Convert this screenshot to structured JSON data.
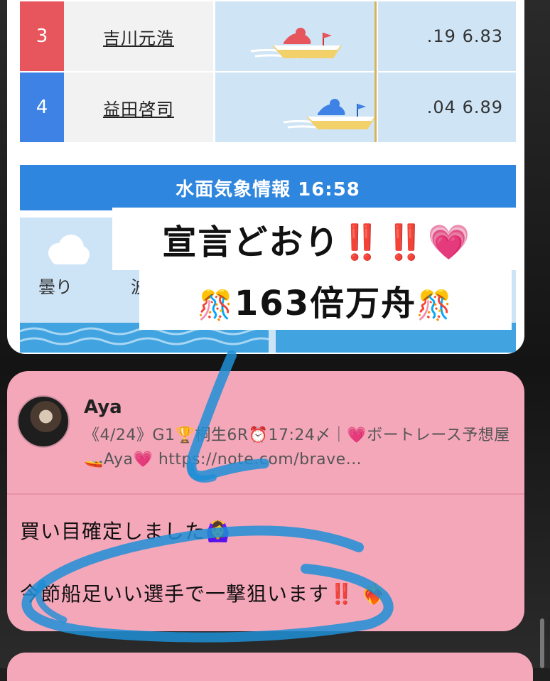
{
  "race": {
    "rows": [
      {
        "lane": "3",
        "name": "吉川元浩",
        "st": ".19  6.83"
      },
      {
        "lane": "4",
        "name": "益田啓司",
        "st": ".04  6.89"
      }
    ],
    "weather_header": "水面気象情報 16:58",
    "weather": "曇り",
    "wave": "波"
  },
  "caption": {
    "line1_text": "宣言どおり",
    "line1_bangs": "‼️‼️",
    "line1_heart": "💗",
    "line2_confetti": "🎊",
    "line2_text": "163倍万舟"
  },
  "note": {
    "author": "Aya",
    "description": "《4/24》G1🏆桐生6R⏰17:24〆｜💗ボートレース予想屋🚤Aya💗 https://note.com/brave...",
    "line1": "買い目確定しました🙆‍♀️",
    "line2_text": "今節船足いい選手で一撃狙います",
    "line2_bangs": "‼️",
    "line2_emoji": "❤️‍🔥"
  },
  "colors": {
    "lane3": "#e8565d",
    "lane4": "#3f82e6",
    "weather_bar": "#2f86de",
    "note_bg": "#f5a7ba",
    "marker": "#1e8fd6"
  }
}
